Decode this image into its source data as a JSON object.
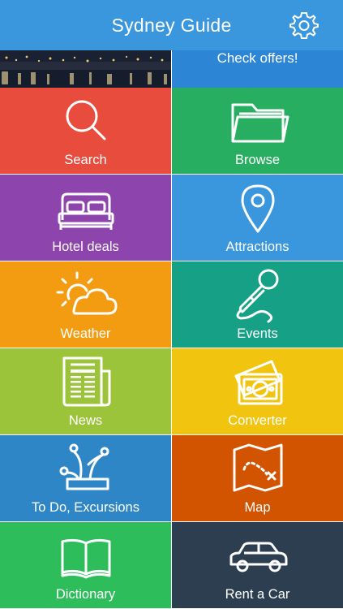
{
  "header": {
    "title": "Sydney Guide",
    "settings_icon": "gear-icon"
  },
  "banner": {
    "offer_text": "Check offers!"
  },
  "colors": {
    "header": "#3a97dd",
    "search": "#e84c3d",
    "browse": "#27ae60",
    "hotel": "#8e44ad",
    "attractions": "#3a97dd",
    "weather": "#f39c12",
    "events": "#16a085",
    "news": "#9bc43a",
    "converter": "#f1c40f",
    "todo": "#2e86c7",
    "map": "#d35400",
    "dictionary": "#2ebd5b",
    "rentcar": "#2c3e50"
  },
  "tiles": [
    {
      "label": "Search",
      "icon": "search-icon"
    },
    {
      "label": "Browse",
      "icon": "folder-icon"
    },
    {
      "label": "Hotel deals",
      "icon": "bed-icon"
    },
    {
      "label": "Attractions",
      "icon": "map-pin-icon"
    },
    {
      "label": "Weather",
      "icon": "sun-cloud-icon"
    },
    {
      "label": "Events",
      "icon": "microphone-icon"
    },
    {
      "label": "News",
      "icon": "newspaper-icon"
    },
    {
      "label": "Converter",
      "icon": "money-icon"
    },
    {
      "label": "To Do, Excursions",
      "icon": "jester-hat-icon"
    },
    {
      "label": "Map",
      "icon": "treasure-map-icon"
    },
    {
      "label": "Dictionary",
      "icon": "book-icon"
    },
    {
      "label": "Rent a Car",
      "icon": "car-icon"
    }
  ]
}
